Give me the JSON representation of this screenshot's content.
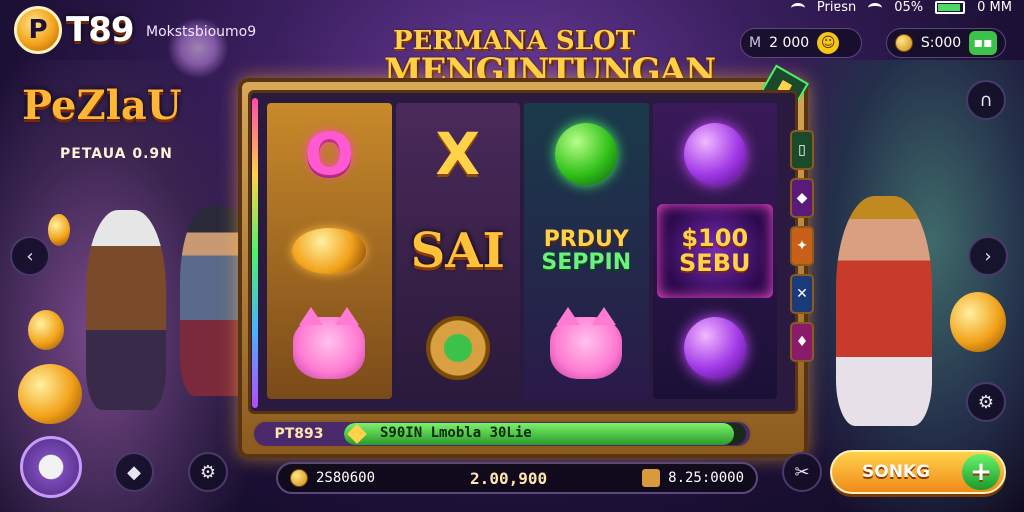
{
  "app": {
    "logo_badge": "P",
    "logo_text": "T89",
    "user_tag": "Mokstsbioumo9"
  },
  "status_bar": {
    "carrier": "Priɐsn",
    "battery_pct": "05%",
    "time": "0 MM"
  },
  "top_pills": {
    "left_value": "2  000",
    "left_label": "M",
    "right_value": "S:000"
  },
  "title": {
    "line1": "PERMANA SLOT",
    "line2": "MENGINTUNGAN"
  },
  "left_panel": {
    "title": "PeZlaU",
    "subtitle": "PETAUA 0.9N"
  },
  "reels": {
    "bonus_text_1": "$100",
    "bonus_text_2": "SEBU",
    "prduy_1": "PRDUY",
    "prduy_2": "SEPPIN",
    "sai": "SAI",
    "o": "O",
    "x": "X"
  },
  "info_bar": {
    "id": "PT893",
    "message": "S90IN Lmobla 30Lie",
    "progress": 0.97
  },
  "bottom_bar": {
    "left_value": "2S80600",
    "center_value": "2.00,900",
    "right_value": "8.25:0000"
  },
  "spin_button": {
    "label": "SONKG",
    "plus": "+"
  },
  "colors": {
    "accent_gold": "#ffd24a",
    "accent_green": "#3cc24a",
    "frame": "#d9a85a"
  },
  "icons": [
    "wifi-icon",
    "battery-icon",
    "coin-icon",
    "smile-icon",
    "menu-icon",
    "magnet-icon",
    "chevron-left-icon",
    "chevron-right-icon",
    "gear-icon",
    "diamond-icon",
    "swords-icon",
    "plus-icon",
    "gift-icon"
  ]
}
